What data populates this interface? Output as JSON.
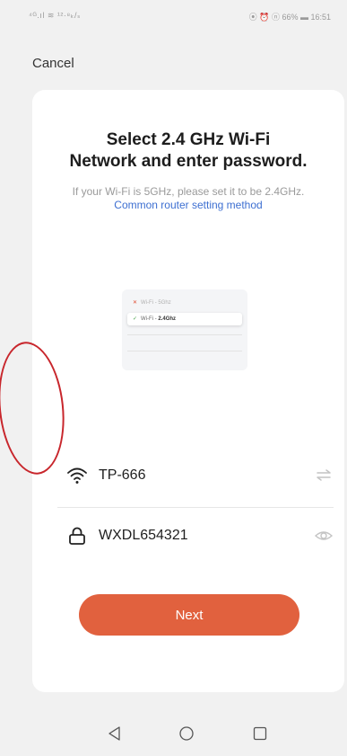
{
  "status_bar": {
    "left_text": "⁴ᴳ.ıl ≋ ¹²·⁸ₖ/ₛ",
    "right_text": "⦿ ⏰ ⓝ 66% ▬ 16:51",
    "battery": "66%",
    "time": "16:51"
  },
  "header": {
    "cancel_label": "Cancel"
  },
  "card": {
    "title_line1": "Select 2.4 GHz Wi-Fi",
    "title_line2": "Network and enter password.",
    "subtitle": "If your Wi-Fi is 5GHz, please set it to be 2.4GHz.",
    "subtitle_link": "Common router setting method",
    "illustration": {
      "row1": "Wi-Fi - 5Ghz",
      "row2_prefix": "Wi-Fi - ",
      "row2_bold": "2.4Ghz"
    },
    "ssid_value": "TP-666",
    "password_value": "WXDL654321",
    "next_label": "Next"
  },
  "colors": {
    "accent": "#e1613e",
    "link": "#3d6fd1",
    "annotation": "#c8262c"
  },
  "icons": {
    "ssid": "wifi-icon",
    "ssid_trailing": "switch-network-icon",
    "password": "lock-icon",
    "password_trailing": "eye-icon",
    "nav": [
      "back-triangle-icon",
      "home-circle-icon",
      "recents-square-icon"
    ]
  }
}
